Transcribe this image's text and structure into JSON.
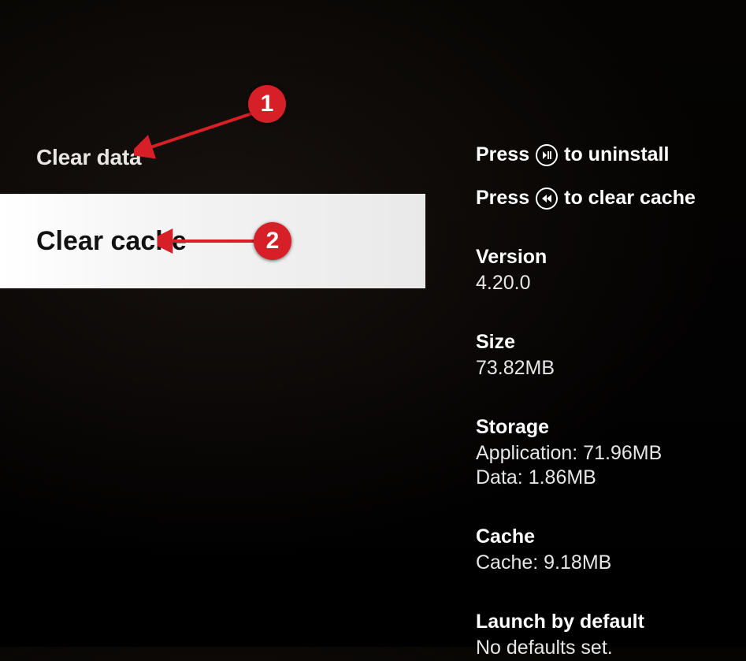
{
  "menu": {
    "clear_data": "Clear data",
    "clear_cache": "Clear cache"
  },
  "hints": {
    "uninstall_prefix": "Press",
    "uninstall_suffix": "to uninstall",
    "clear_cache_prefix": "Press",
    "clear_cache_suffix": "to clear cache"
  },
  "info": {
    "version_label": "Version",
    "version_value": "4.20.0",
    "size_label": "Size",
    "size_value": "73.82MB",
    "storage_label": "Storage",
    "storage_app": "Application: 71.96MB",
    "storage_data": "Data: 1.86MB",
    "cache_label": "Cache",
    "cache_value": "Cache: 9.18MB",
    "launch_label": "Launch by default",
    "launch_value": "No defaults set."
  },
  "annotations": {
    "badge1": "1",
    "badge2": "2"
  }
}
